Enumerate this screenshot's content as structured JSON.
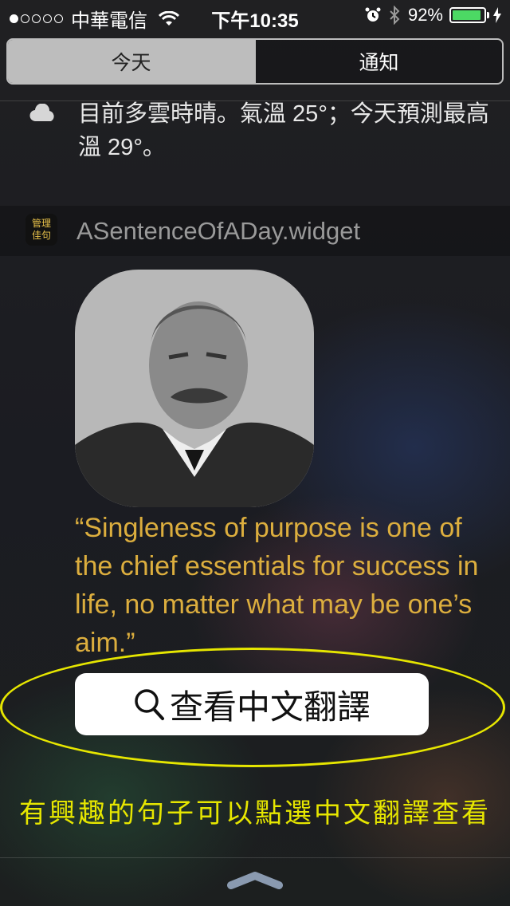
{
  "status_bar": {
    "carrier": "中華電信",
    "signal_bars_filled": 1,
    "signal_bars_total": 5,
    "time": "下午10:35",
    "battery_percent": "92%",
    "battery_level": 0.92
  },
  "tabs": [
    {
      "label": "今天",
      "active": true
    },
    {
      "label": "通知",
      "active": false
    }
  ],
  "weather": {
    "icon": "cloud-icon",
    "text": "目前多雲時晴。氣溫 25°；今天預測最高溫 29°。"
  },
  "widget": {
    "icon_text_line1": "管理",
    "icon_text_line2": "佳句",
    "title": "ASentenceOfADay.widget",
    "quote": "“Singleness of purpose is one of the chief essentials for success in life, no matter what may be one’s aim.”",
    "translate_button_label": "查看中文翻譯"
  },
  "annotation_caption": "有興趣的句子可以點選中文翻譯查看",
  "colors": {
    "quote": "#dcae3e",
    "annotation": "#e6e600",
    "battery": "#4cd964"
  }
}
